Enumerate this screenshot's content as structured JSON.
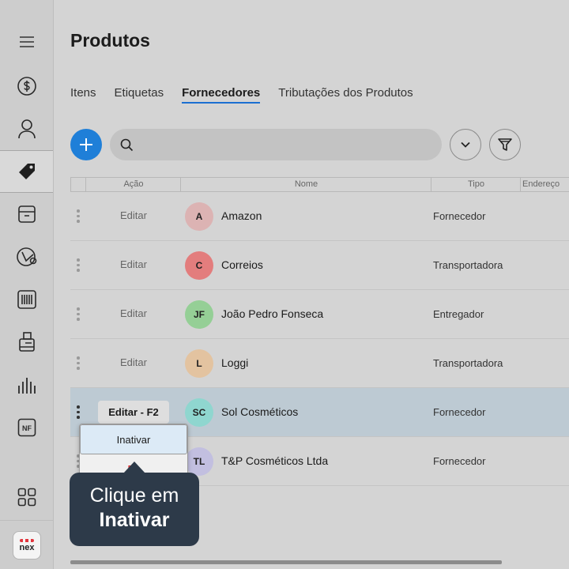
{
  "app": {
    "logo_text": "nex"
  },
  "header": {
    "title": "Produtos"
  },
  "tabs": [
    {
      "label": "Itens",
      "active": false
    },
    {
      "label": "Etiquetas",
      "active": false
    },
    {
      "label": "Fornecedores",
      "active": true
    },
    {
      "label": "Tributações dos Produtos",
      "active": false
    }
  ],
  "search": {
    "placeholder": "",
    "value": ""
  },
  "table": {
    "columns": [
      "Ação",
      "Nome",
      "Tipo",
      "Endereço"
    ],
    "rows": [
      {
        "action": "Editar",
        "initials": "A",
        "avatar_color": "#dcb3b3",
        "name": "Amazon",
        "tipo": "Fornecedor"
      },
      {
        "action": "Editar",
        "initials": "C",
        "avatar_color": "#e37d7d",
        "name": "Correios",
        "tipo": "Transportadora"
      },
      {
        "action": "Editar",
        "initials": "JF",
        "avatar_color": "#95cf96",
        "name": "João Pedro Fonseca",
        "tipo": "Entregador"
      },
      {
        "action": "Editar",
        "initials": "L",
        "avatar_color": "#e3c3a0",
        "name": "Loggi",
        "tipo": "Transportadora"
      },
      {
        "action": "Editar - F2",
        "initials": "SC",
        "avatar_color": "#8fd6cf",
        "name": "Sol Cosméticos",
        "tipo": "Fornecedor",
        "selected": true
      },
      {
        "action": "",
        "initials": "TL",
        "avatar_color": "#c2bfe0",
        "name": "T&P Cosméticos Ltda",
        "tipo": "Fornecedor"
      }
    ]
  },
  "context_menu": {
    "items": [
      "Inativar",
      "Ex"
    ]
  },
  "tooltip": {
    "line1": "Clique em",
    "line2": "Inativar"
  },
  "colors": {
    "primary": "#1f7fd8",
    "tooltip_bg": "#2d3a49",
    "danger": "#e02020"
  }
}
